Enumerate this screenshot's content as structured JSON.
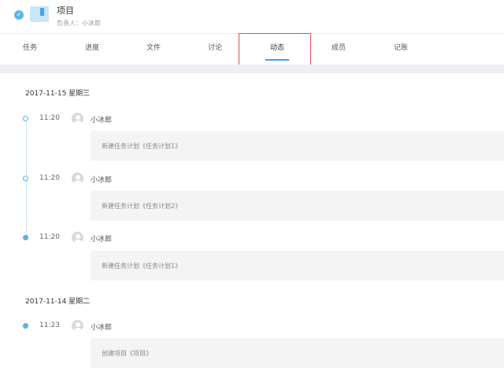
{
  "project": {
    "title": "项目",
    "owner": "负责人：小冰郎"
  },
  "tabs": [
    {
      "label": "任务",
      "active": false
    },
    {
      "label": "进度",
      "active": false
    },
    {
      "label": "文件",
      "active": false
    },
    {
      "label": "讨论",
      "active": false
    },
    {
      "label": "动态",
      "active": true
    },
    {
      "label": "成员",
      "active": false
    },
    {
      "label": "记账",
      "active": false
    }
  ],
  "feed": [
    {
      "date": "2017-11-15 星期三",
      "entries": [
        {
          "time": "11:20",
          "user": "小冰郎",
          "content": "新建任务计划《任务计划1》"
        },
        {
          "time": "11:20",
          "user": "小冰郎",
          "content": "新建任务计划《任务计划2》"
        },
        {
          "time": "11:20",
          "user": "小冰郎",
          "content": "新建任务计划《任务计划1》"
        }
      ]
    },
    {
      "date": "2017-11-14 星期二",
      "entries": [
        {
          "time": "11:23",
          "user": "小冰郎",
          "content": "创建项目《项目》"
        }
      ]
    }
  ],
  "colors": {
    "accent": "#4a9de0",
    "highlight_border": "#e05050",
    "content_bg": "#f4f4f5"
  }
}
